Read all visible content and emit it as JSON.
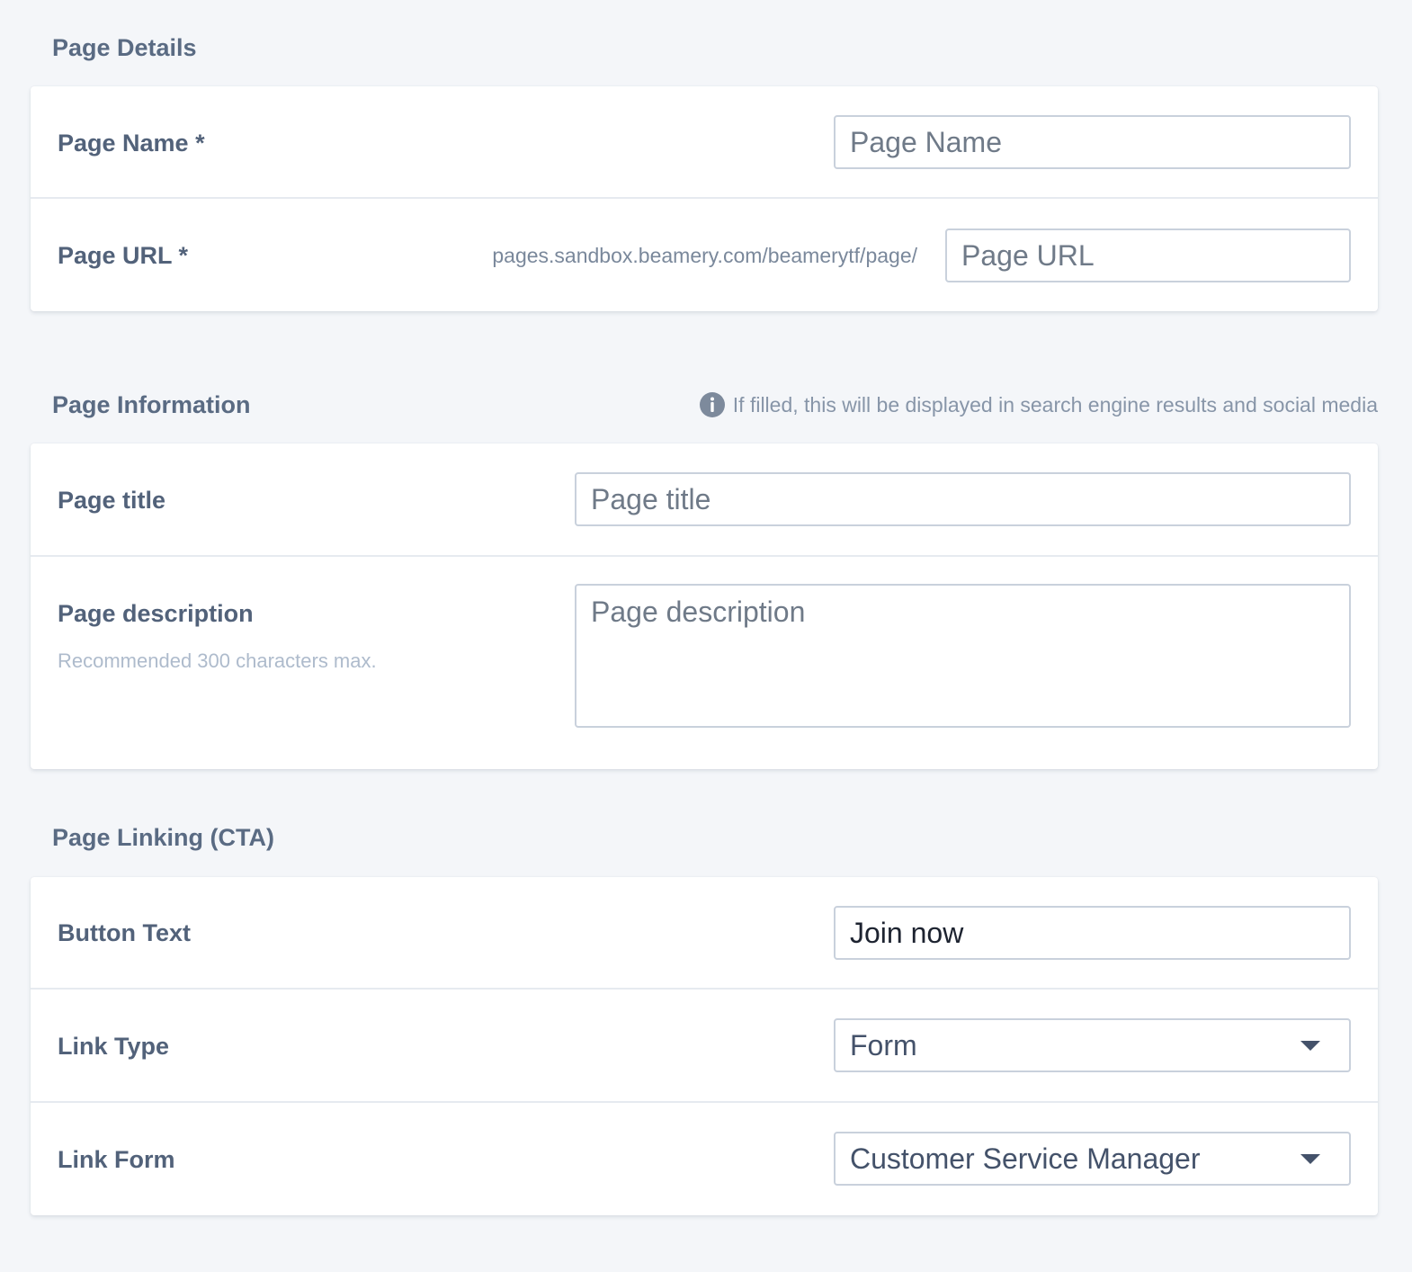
{
  "page_details": {
    "title": "Page Details",
    "page_name": {
      "label": "Page Name *",
      "placeholder": "Page Name",
      "value": ""
    },
    "page_url": {
      "label": "Page URL *",
      "prefix": "pages.sandbox.beamery.com/beamerytf/page/",
      "placeholder": "Page URL",
      "value": ""
    }
  },
  "page_information": {
    "title": "Page Information",
    "info_note": "If filled, this will be displayed in search engine results and social media",
    "info_icon": "info-circle-icon",
    "page_title": {
      "label": "Page title",
      "placeholder": "Page title",
      "value": ""
    },
    "page_description": {
      "label": "Page description",
      "hint": "Recommended 300 characters max.",
      "placeholder": "Page description",
      "value": ""
    }
  },
  "page_linking": {
    "title": "Page Linking (CTA)",
    "button_text": {
      "label": "Button Text",
      "value": "Join now"
    },
    "link_type": {
      "label": "Link Type",
      "selected": "Form"
    },
    "link_form": {
      "label": "Link Form",
      "selected": "Customer Service Manager"
    }
  },
  "colors": {
    "background": "#f4f6f9",
    "card": "#ffffff",
    "label": "#52627a",
    "border": "#c9d1dc"
  }
}
